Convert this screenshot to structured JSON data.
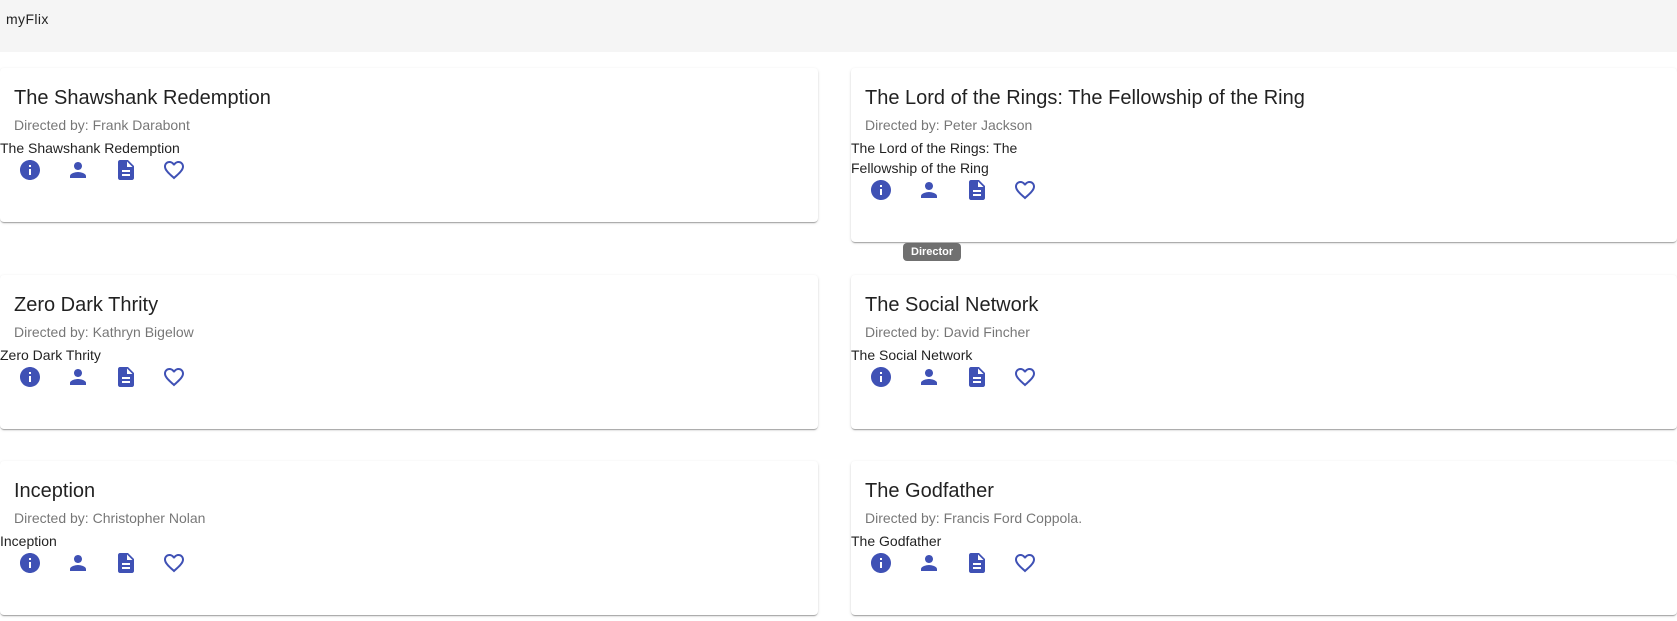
{
  "app": {
    "title": "myFlix"
  },
  "tooltip": {
    "text": "Director"
  },
  "movies": [
    {
      "title": "The Shawshank Redemption",
      "director_line": "Directed by: Frank Darabont",
      "image_alt_lines": [
        "The Shawshank Redemption"
      ]
    },
    {
      "title": "The Lord of the Rings: The Fellowship of the Ring",
      "director_line": "Directed by: Peter Jackson",
      "image_alt_lines": [
        "The Lord of the Rings: The",
        "Fellowship of the Ring"
      ]
    },
    {
      "title": "Zero Dark Thrity",
      "director_line": "Directed by: Kathryn Bigelow",
      "image_alt_lines": [
        "Zero Dark Thrity"
      ]
    },
    {
      "title": "The Social Network",
      "director_line": "Directed by: David Fincher",
      "image_alt_lines": [
        "The Social Network"
      ]
    },
    {
      "title": "Inception",
      "director_line": "Directed by: Christopher Nolan",
      "image_alt_lines": [
        "Inception"
      ]
    },
    {
      "title": "The Godfather",
      "director_line": "Directed by: Francis Ford Coppola.",
      "image_alt_lines": [
        "The Godfather"
      ]
    }
  ],
  "icons": {
    "info": "info-icon",
    "director": "person-icon",
    "description": "description-icon",
    "favorite": "favorite-border-icon"
  },
  "colors": {
    "accent": "#3f51b5",
    "toolbar": "#f5f5f5"
  }
}
